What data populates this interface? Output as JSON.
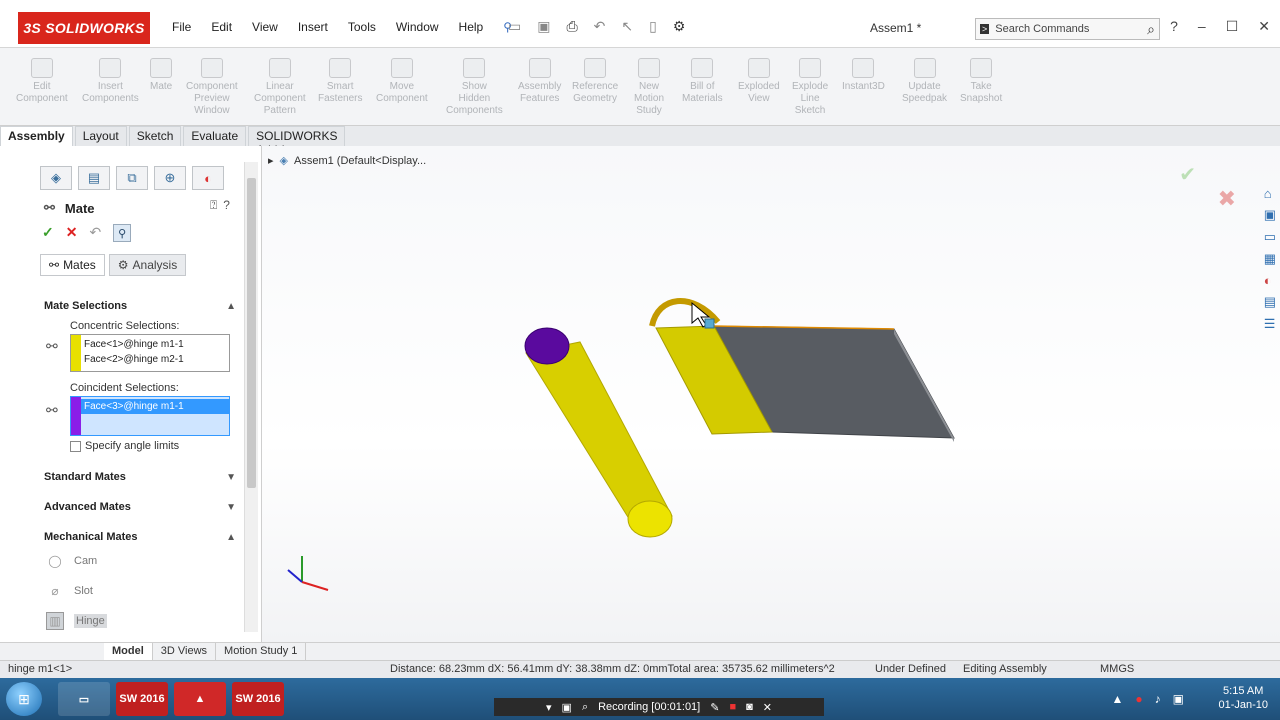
{
  "app": {
    "logo": "3S SOLIDWORKS",
    "doc_title": "Assem1 *"
  },
  "menu": [
    "File",
    "Edit",
    "View",
    "Insert",
    "Tools",
    "Window",
    "Help"
  ],
  "search": {
    "placeholder": "Search Commands"
  },
  "ribbon": [
    {
      "label": "Edit Component",
      "lines": [
        "Edit",
        "Component"
      ]
    },
    {
      "label": "Insert Components",
      "lines": [
        "Insert",
        "Components"
      ]
    },
    {
      "label": "Mate",
      "lines": [
        "Mate"
      ]
    },
    {
      "label": "Component Preview Window",
      "lines": [
        "Component",
        "Preview",
        "Window"
      ]
    },
    {
      "label": "Linear Component Pattern",
      "lines": [
        "Linear",
        "Component",
        "Pattern"
      ]
    },
    {
      "label": "Smart Fasteners",
      "lines": [
        "Smart",
        "Fasteners"
      ]
    },
    {
      "label": "Move Component",
      "lines": [
        "Move",
        "Component"
      ]
    },
    {
      "label": "Show Hidden Components",
      "lines": [
        "Show",
        "Hidden",
        "Components"
      ]
    },
    {
      "label": "Assembly Features",
      "lines": [
        "Assembly",
        "Features"
      ]
    },
    {
      "label": "Reference Geometry",
      "lines": [
        "Reference",
        "Geometry"
      ]
    },
    {
      "label": "New Motion Study",
      "lines": [
        "New",
        "Motion",
        "Study"
      ]
    },
    {
      "label": "Bill of Materials",
      "lines": [
        "Bill of",
        "Materials"
      ]
    },
    {
      "label": "Exploded View",
      "lines": [
        "Exploded",
        "View"
      ]
    },
    {
      "label": "Explode Line Sketch",
      "lines": [
        "Explode",
        "Line",
        "Sketch"
      ]
    },
    {
      "label": "Instant3D",
      "lines": [
        "Instant3D"
      ]
    },
    {
      "label": "Update Speedpak",
      "lines": [
        "Update",
        "Speedpak"
      ]
    },
    {
      "label": "Take Snapshot",
      "lines": [
        "Take",
        "Snapshot"
      ]
    }
  ],
  "tabs": [
    "Assembly",
    "Layout",
    "Sketch",
    "Evaluate",
    "SOLIDWORKS Add-Ins"
  ],
  "panel": {
    "title": "Mate",
    "subtabs": [
      "Mates",
      "Analysis"
    ],
    "mate_selections": "Mate Selections",
    "concentric_label": "Concentric Selections:",
    "concentric_items": [
      "Face<1>@hinge m1-1",
      "Face<2>@hinge m2-1"
    ],
    "coincident_label": "Coincident Selections:",
    "coincident_items": [
      "Face<3>@hinge m1-1"
    ],
    "angle_limits": "Specify angle limits",
    "standard": "Standard Mates",
    "advanced": "Advanced Mates",
    "mechanical": "Mechanical Mates",
    "mech_items": [
      "Cam",
      "Slot",
      "Hinge"
    ]
  },
  "viewport": {
    "tree_root": "Assem1  (Default<Display..."
  },
  "bottom_tabs": [
    "Model",
    "3D Views",
    "Motion Study 1"
  ],
  "status": {
    "left": "hinge m1<1>",
    "measure": "Distance: 68.23mm   dX: 56.41mm  dY: 38.38mm  dZ: 0mmTotal area: 35735.62 millimeters^2",
    "state": "Under Defined",
    "mode": "Editing Assembly",
    "units": "MMGS"
  },
  "taskbar": {
    "recording": "Recording [00:01:01]",
    "time": "5:15 AM",
    "date": "01-Jan-10",
    "apps": [
      "SW 2016",
      "SW 2016"
    ]
  },
  "colors": {
    "yellow_part": "#e8e000",
    "purple_face": "#5a0a9e",
    "gray_plate": "#585c62",
    "selection_blue": "#3399ff"
  }
}
